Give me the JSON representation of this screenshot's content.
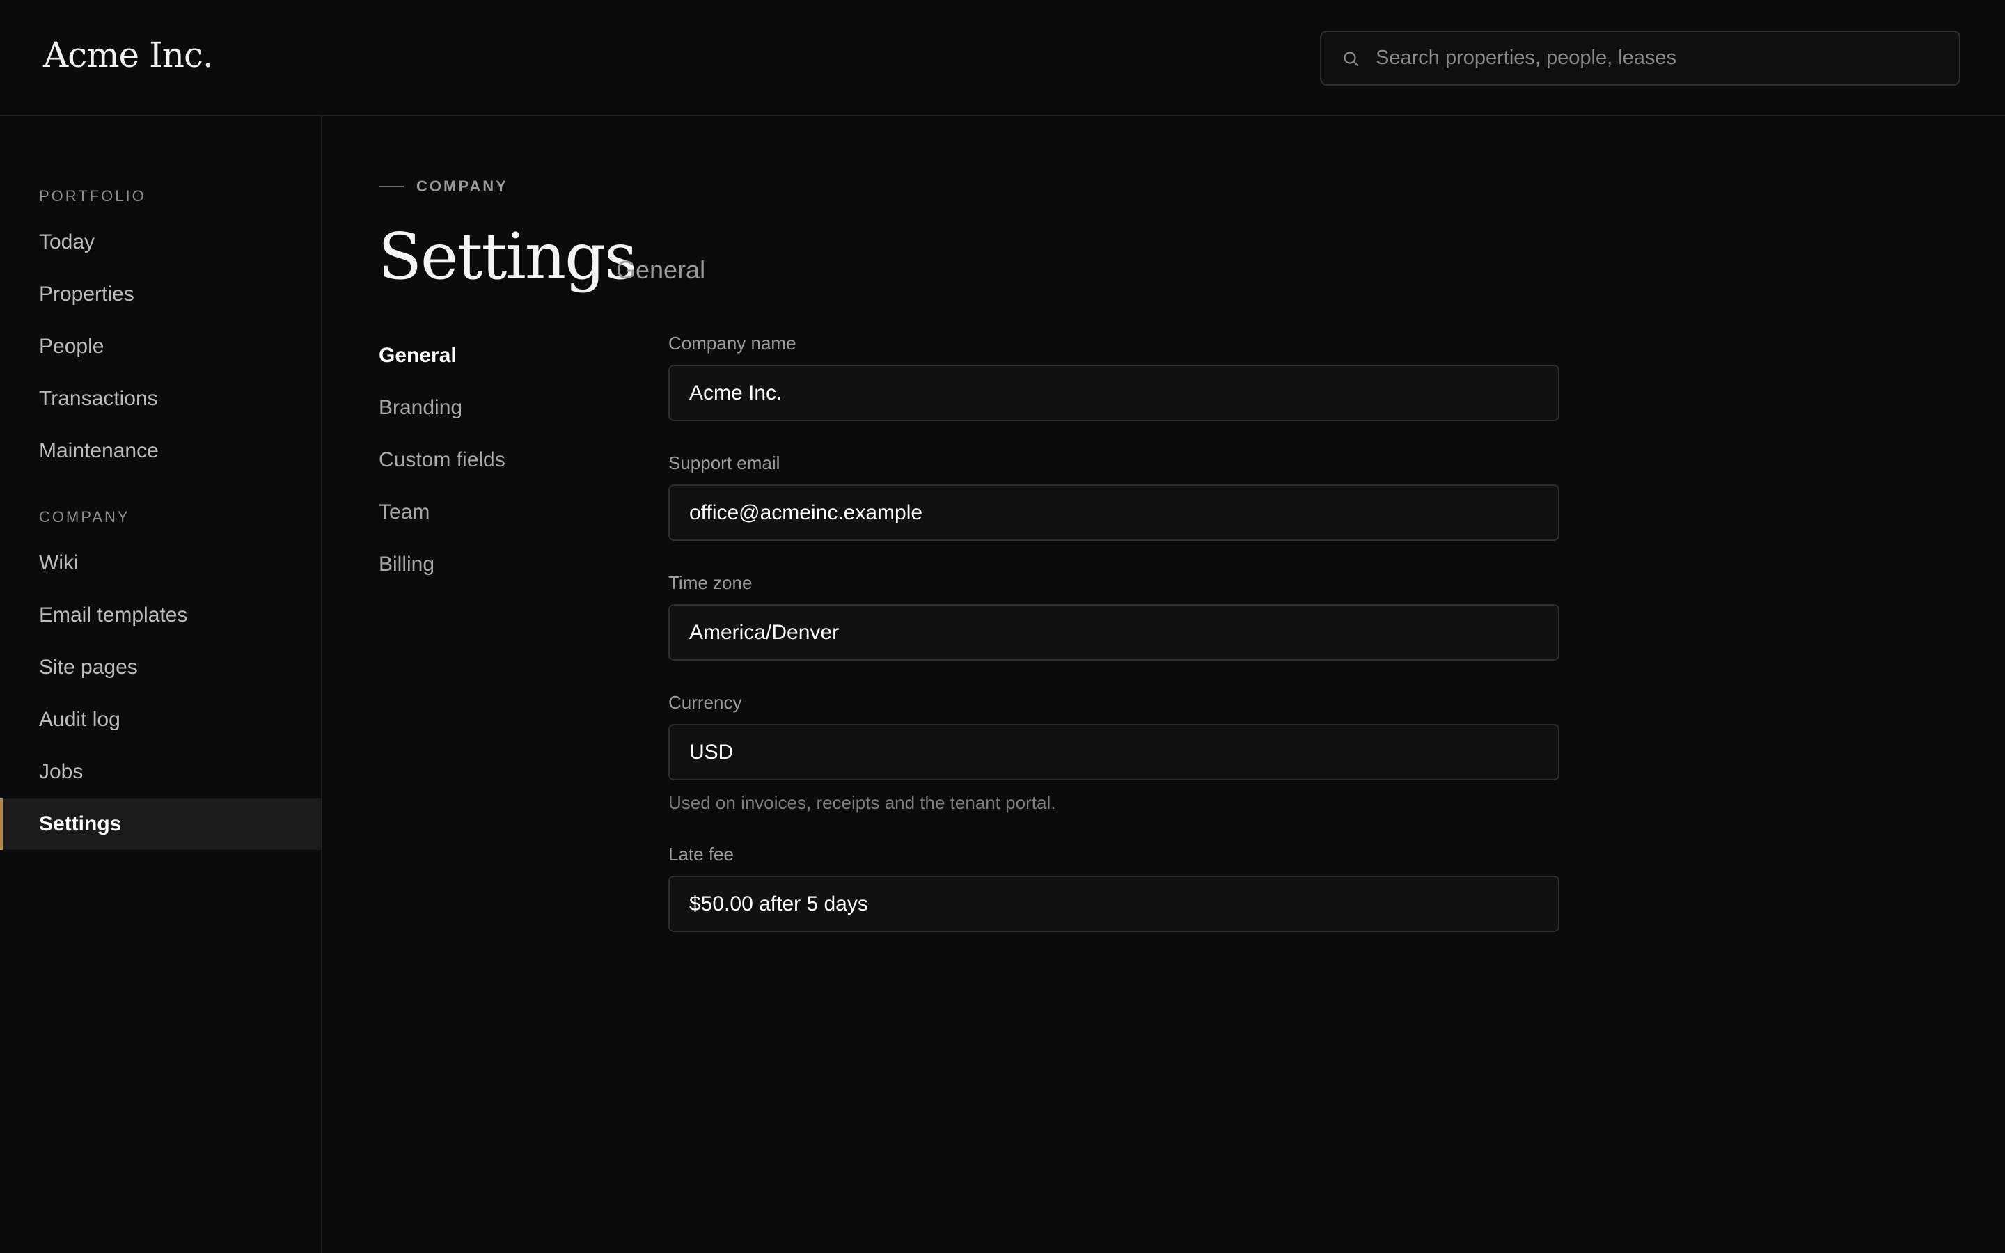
{
  "header": {
    "logo": "Acme Inc.",
    "search_placeholder": "Search properties, people, leases"
  },
  "sidebar": {
    "sections": [
      {
        "label": "PORTFOLIO",
        "items": [
          "Today",
          "Properties",
          "People",
          "Transactions",
          "Maintenance"
        ]
      },
      {
        "label": "COMPANY",
        "items": [
          "Wiki",
          "Email templates",
          "Site pages",
          "Audit log",
          "Jobs",
          "Settings"
        ]
      }
    ],
    "active_item": "Settings"
  },
  "main": {
    "eyebrow": "COMPANY",
    "title": "Settings",
    "subtitle": "General",
    "subnav": [
      "General",
      "Branding",
      "Custom fields",
      "Team",
      "Billing"
    ],
    "subnav_active": "General",
    "fields": {
      "company_name": {
        "label": "Company name",
        "value": "Acme Inc."
      },
      "support_email": {
        "label": "Support email",
        "value": "office@acmeinc.example"
      },
      "time_zone": {
        "label": "Time zone",
        "value": "America/Denver"
      },
      "currency": {
        "label": "Currency",
        "value": "USD",
        "help": "Used on invoices, receipts and the tenant portal."
      },
      "late_fee": {
        "label": "Late fee",
        "value": "$50.00 after 5 days"
      }
    }
  },
  "colors": {
    "background": "#0b0b0b",
    "accent": "#b08a4a",
    "active_row": "#1b1b1b"
  }
}
